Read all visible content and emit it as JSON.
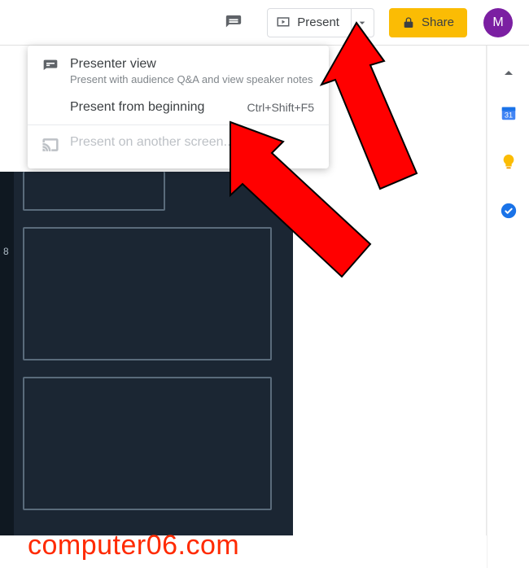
{
  "toolbar": {
    "present_label": "Present",
    "share_label": "Share",
    "avatar_initial": "M"
  },
  "dropdown": {
    "items": [
      {
        "label": "Presenter view",
        "sub": "Present with audience Q&A and view speaker notes"
      },
      {
        "label": "Present from beginning",
        "shortcut": "Ctrl+Shift+F5"
      },
      {
        "label": "Present on another screen..."
      }
    ]
  },
  "thumb_panel": {
    "visible_slide_number": "8"
  },
  "watermark": "computer06.com"
}
